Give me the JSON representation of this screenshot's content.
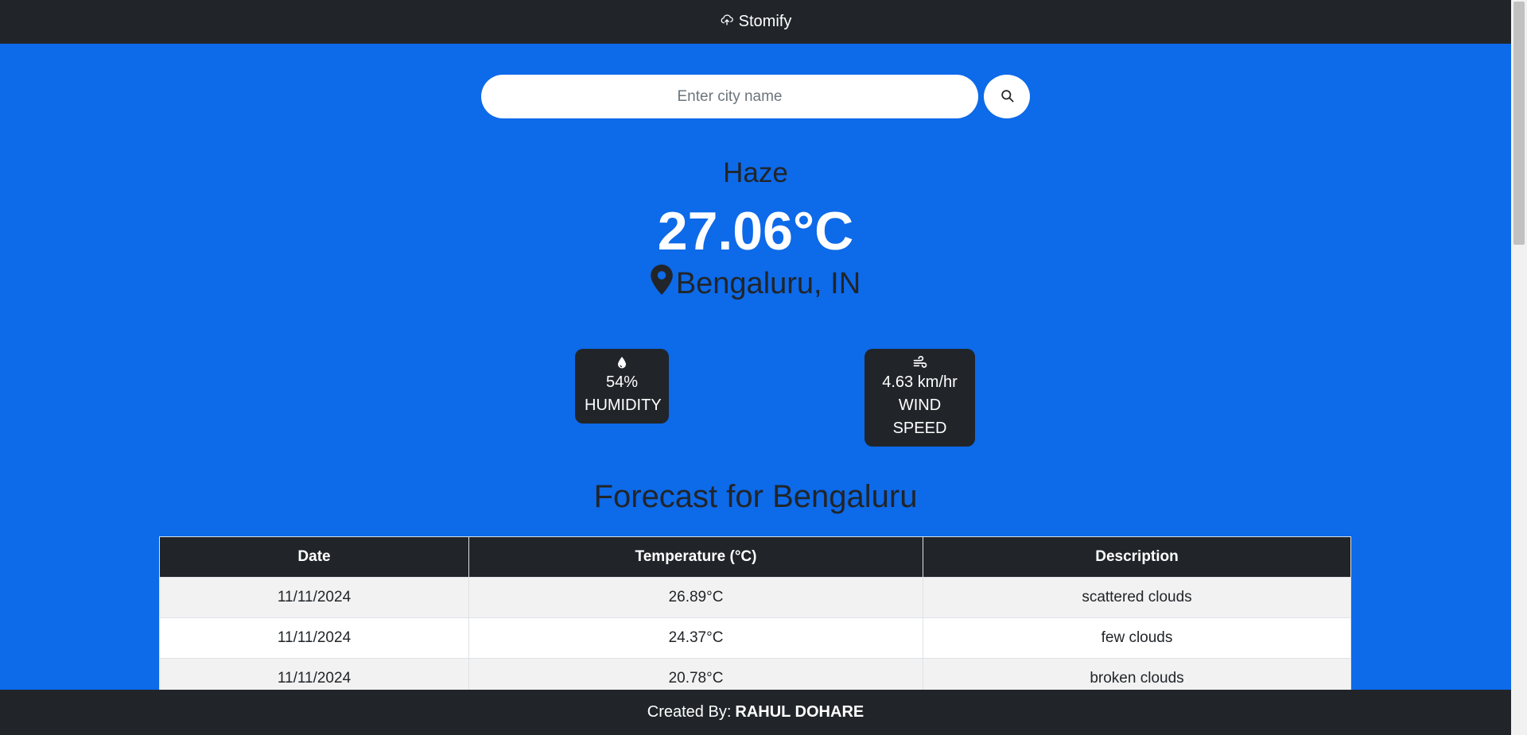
{
  "navbar": {
    "brand": "Stomify",
    "icon": "cloud-icon"
  },
  "search": {
    "placeholder": "Enter city name",
    "value": "",
    "button_icon": "search-icon"
  },
  "weather": {
    "condition": "Haze",
    "temperature": "27.06°C",
    "location": "Bengaluru, IN",
    "location_icon": "location-pin-icon"
  },
  "stats": {
    "humidity": {
      "icon": "droplet-icon",
      "value": "54%",
      "label": "HUMIDITY"
    },
    "wind": {
      "icon": "wind-icon",
      "value": "4.63 km/hr",
      "label": "WIND SPEED"
    }
  },
  "forecast": {
    "title": "Forecast for Bengaluru",
    "columns": [
      "Date",
      "Temperature (°C)",
      "Description"
    ],
    "rows": [
      [
        "11/11/2024",
        "26.89°C",
        "scattered clouds"
      ],
      [
        "11/11/2024",
        "24.37°C",
        "few clouds"
      ],
      [
        "11/11/2024",
        "20.78°C",
        "broken clouds"
      ]
    ]
  },
  "footer": {
    "prefix": "Created By:",
    "author": "RAHUL DOHARE"
  },
  "colors": {
    "background": "#0d6ae9",
    "dark": "#212529",
    "white": "#ffffff"
  }
}
